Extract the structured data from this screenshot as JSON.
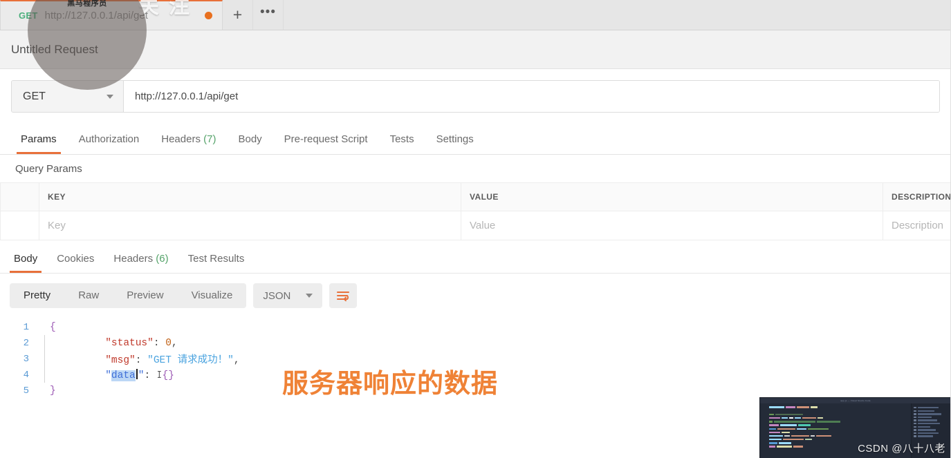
{
  "window": {
    "watermark_avatar_text": "黑马程序员",
    "watermark_bg_text": "关注"
  },
  "tabstrip": {
    "tab": {
      "method": "GET",
      "url": "http://127.0.0.1/api/get",
      "unsaved_indicator": "unsaved-dot"
    },
    "new_tab_label": "+",
    "more_label": "•••"
  },
  "request": {
    "title": "Untitled Request",
    "method": "GET",
    "url": "http://127.0.0.1/api/get",
    "tabs": [
      {
        "label": "Params",
        "count": "",
        "active": true
      },
      {
        "label": "Authorization",
        "count": "",
        "active": false
      },
      {
        "label": "Headers",
        "count": "(7)",
        "active": false
      },
      {
        "label": "Body",
        "count": "",
        "active": false
      },
      {
        "label": "Pre-request Script",
        "count": "",
        "active": false
      },
      {
        "label": "Tests",
        "count": "",
        "active": false
      },
      {
        "label": "Settings",
        "count": "",
        "active": false
      }
    ]
  },
  "query_params": {
    "section_title": "Query Params",
    "columns": [
      "",
      "KEY",
      "VALUE",
      "DESCRIPTION"
    ],
    "rows": [
      {
        "key_placeholder": "Key",
        "value_placeholder": "Value",
        "description_placeholder": "Description"
      }
    ]
  },
  "response": {
    "tabs": [
      {
        "label": "Body",
        "count": "",
        "active": true
      },
      {
        "label": "Cookies",
        "count": "",
        "active": false
      },
      {
        "label": "Headers",
        "count": "(6)",
        "active": false
      },
      {
        "label": "Test Results",
        "count": "",
        "active": false
      }
    ],
    "view_modes": [
      {
        "label": "Pretty",
        "active": true
      },
      {
        "label": "Raw",
        "active": false
      },
      {
        "label": "Preview",
        "active": false
      },
      {
        "label": "Visualize",
        "active": false
      }
    ],
    "format": "JSON",
    "wrap_icon": "wrap-lines-icon",
    "body_lines": [
      {
        "n": "1",
        "text": "{"
      },
      {
        "n": "2",
        "text": "    \"status\": 0,"
      },
      {
        "n": "3",
        "text": "    \"msg\": \"GET 请求成功！\","
      },
      {
        "n": "4",
        "text": "    \"data\": {}"
      },
      {
        "n": "5",
        "text": "}"
      }
    ],
    "body_tokens": {
      "l1_brace": "{",
      "l2_key": "\"status\"",
      "l2_colon": ": ",
      "l2_value": "0",
      "l2_comma": ",",
      "l3_key": "\"msg\"",
      "l3_colon": ": ",
      "l3_value": "\"GET 请求成功！\"",
      "l3_comma": ",",
      "l4_key_open": "\"",
      "l4_key_sel": "data",
      "l4_key_close": "\"",
      "l4_colon": ": ",
      "l4_value": "{}",
      "l5_brace": "}"
    },
    "selected_text": "data"
  },
  "annotation": {
    "text": "服务器响应的数据",
    "color": "#ef8236"
  },
  "inset": {
    "watermark": "CSDN @八十八老",
    "editor_title": "app.js — Visual Studio Code"
  },
  "colors": {
    "accent_orange": "#e8703a",
    "green_count": "#55a36a",
    "method_green": "#4caf7d",
    "line_number_blue": "#5b9bd5",
    "selection_blue": "#bcd7f5"
  }
}
